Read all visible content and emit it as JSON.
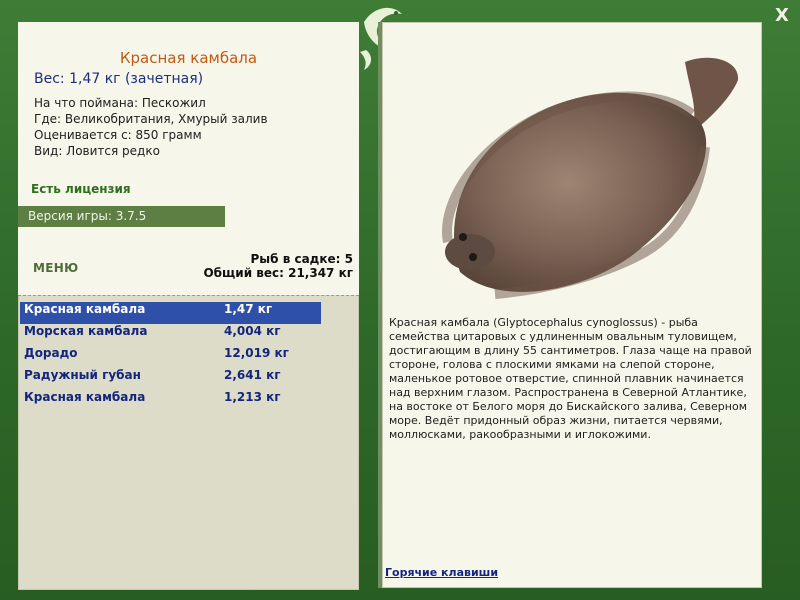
{
  "window": {
    "close_label": "X",
    "colors": {
      "frame": "#2f6a2a",
      "panel": "#f7f6ea",
      "accent": "#c05a14",
      "selection": "#2e50a8",
      "link": "#14257e"
    }
  },
  "fish": {
    "title": "Красная камбала",
    "weight_line": "Вес: 1,47 кг (зачетная)",
    "info": [
      "На что поймана: Пескожил",
      "Где: Великобритания, Хмурый залив",
      "Оценивается с: 850 грамм",
      "Вид: Ловится редко"
    ],
    "license": "Есть лицензия",
    "version": "Версия игры: 3.7.5"
  },
  "menu_label": "МЕНЮ",
  "stats": {
    "fish_in_keepnet": "Рыб в садке: 5",
    "total_weight": "Общий вес: 21,347 кг"
  },
  "catch": [
    {
      "name": "Красная камбала",
      "weight": "1,47 кг",
      "selected": true
    },
    {
      "name": "Морская камбала",
      "weight": "4,004 кг",
      "selected": false
    },
    {
      "name": "Дорадо",
      "weight": "12,019 кг",
      "selected": false
    },
    {
      "name": "Радужный губан",
      "weight": "2,641 кг",
      "selected": false
    },
    {
      "name": "Красная камбала",
      "weight": "1,213 кг",
      "selected": false
    }
  ],
  "description": "Красная камбала (Glyptocephalus cynoglossus) - рыба семейства цитаровых с удлиненным овальным туловищем, достигающим в длину 55 сантиметров. Глаза чаще на правой стороне, голова с плоскими ямками на слепой стороне, маленькое ротовое отверстие, спинной плавник начинается над верхним глазом. Распространена в Северной Атлантике, на востоке от Белого моря до Бискайского залива, Северном море. Ведёт придонный образ жизни, питается червями, моллюсками, ракообразными и иглокожими.",
  "hotkeys_label": "Горячие клавиши",
  "icons": {
    "logo": "fish-logo-icon",
    "close": "close-icon",
    "fish_image": "flounder-image"
  }
}
